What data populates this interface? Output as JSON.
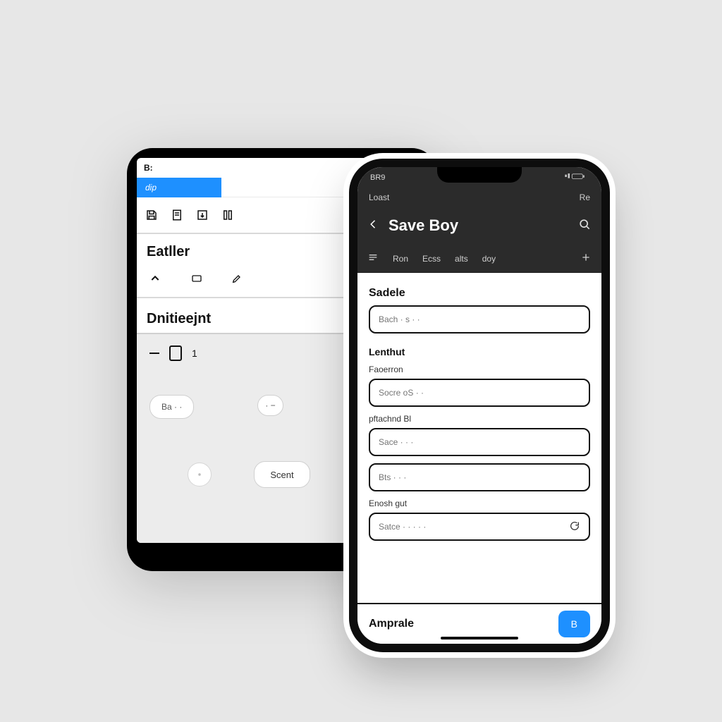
{
  "tablet": {
    "status_left": "B:",
    "bluebar_label": "dip",
    "section1_title": "Eatller",
    "section2_title": "Dnitieejnt",
    "grey_value": "1",
    "pill1": "Ba · ·",
    "pill2": "·",
    "center_button": "Scent"
  },
  "phone": {
    "status_left": "BR9",
    "status_right": "·",
    "subbar_left": "Loast",
    "subbar_right": "Re",
    "header_title": "Save Boy",
    "tabs": [
      "Ron",
      "Ecss",
      "alts",
      "doy"
    ],
    "section_label": "Sadele",
    "input1_placeholder": "Bach · s · ·",
    "group_label": "Lenthut",
    "field1_label": "Faoerron",
    "field1_placeholder": "Socre oS · ·",
    "field2_label": "pftachnd Bl",
    "field2_placeholder": "Sace · · ·",
    "field3_placeholder": "Bts · · ·",
    "field4_label": "Enosh gut",
    "field4_placeholder": "Satce · · · · ·",
    "footer_label": "Amprale",
    "footer_button": "B"
  },
  "colors": {
    "accent": "#1e90ff"
  }
}
